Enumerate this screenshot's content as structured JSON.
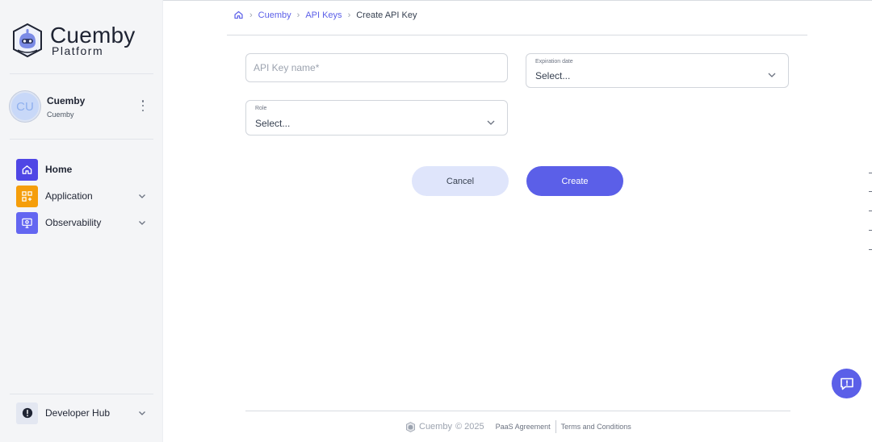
{
  "brand": {
    "name": "Cuemby",
    "subtitle": "Platform"
  },
  "user": {
    "initials": "CU",
    "name": "Cuemby",
    "org": "Cuemby"
  },
  "nav": {
    "items": [
      {
        "label": "Home",
        "icon": "home-icon",
        "color": "#4f46e5",
        "active": true
      },
      {
        "label": "Application",
        "icon": "apps-icon",
        "color": "#f59e0b",
        "expandable": true
      },
      {
        "label": "Observability",
        "icon": "monitor-icon",
        "color": "#6366f1",
        "expandable": true
      }
    ],
    "bottom": {
      "label": "Developer Hub",
      "icon": "alert-circle-icon"
    }
  },
  "breadcrumb": {
    "items": [
      "Cuemby",
      "API Keys"
    ],
    "current": "Create API Key"
  },
  "form": {
    "api_key_name": {
      "placeholder": "API Key name*",
      "value": ""
    },
    "expiration": {
      "label": "Expiration date",
      "value": "Select..."
    },
    "role": {
      "label": "Role",
      "value": "Select..."
    },
    "cancel_label": "Cancel",
    "create_label": "Create"
  },
  "footer": {
    "brand": "Cuemby",
    "year": "© 2025",
    "links": [
      "PaaS Agreement",
      "Terms and Conditions"
    ]
  },
  "colors": {
    "accent": "#5b5fe8",
    "sidebar_bg": "#f4f5f7",
    "cancel_bg": "#dfe5fb"
  }
}
